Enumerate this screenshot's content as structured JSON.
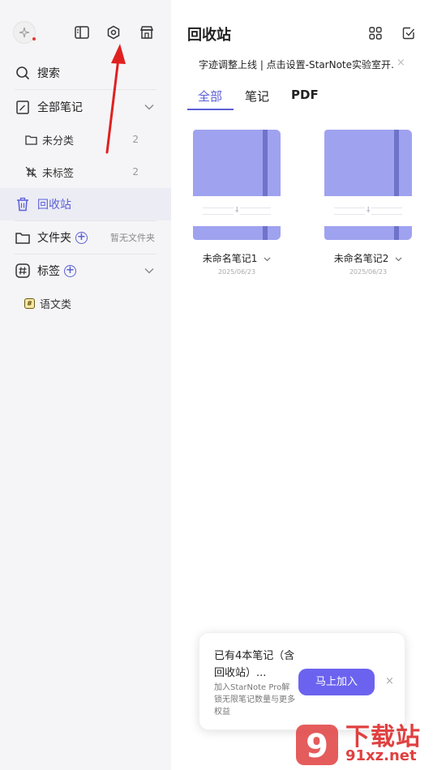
{
  "sidebar": {
    "avatar_icon": "sparkle-icon",
    "toolbar_icons": [
      "sidebar-toggle-icon",
      "settings-hexagon-icon",
      "store-icon"
    ],
    "search_label": "搜索",
    "all_notes_label": "全部笔记",
    "uncategorized_label": "未分类",
    "uncategorized_count": "2",
    "untagged_label": "未标签",
    "untagged_count": "2",
    "trash_label": "回收站",
    "folders_label": "文件夹",
    "folders_empty_hint": "暂无文件夹",
    "tags_label": "标签",
    "tag_items": [
      {
        "label": "语文类",
        "chip": "#"
      }
    ]
  },
  "main": {
    "title": "回收站",
    "notice_text": "字迹调整上线 | 点击设置-StarNote实验室开…",
    "notice_close": "×",
    "tabs": [
      {
        "label": "全部",
        "active": true
      },
      {
        "label": "笔记",
        "active": false
      },
      {
        "label": "PDF",
        "active": false
      }
    ],
    "notes": [
      {
        "title": "未命名笔记1",
        "date": "2025/06/23",
        "cover_color": "#9fa2ef"
      },
      {
        "title": "未命名笔记2",
        "date": "2025/06/23",
        "cover_color": "#9fa2ef"
      }
    ]
  },
  "promo": {
    "title": "已有4本笔记（含回收站）...",
    "subtitle": "加入StarNote Pro解锁无限笔记数量与更多权益",
    "button_label": "马上加入",
    "close": "×"
  },
  "watermark": {
    "logo_text": "9",
    "brand_cn": "下载站",
    "url": "91xz.net"
  },
  "colors": {
    "accent": "#5b5fd6",
    "button": "#6b63ef",
    "notebook": "#9fa2ef",
    "arrow": "#e02020"
  }
}
